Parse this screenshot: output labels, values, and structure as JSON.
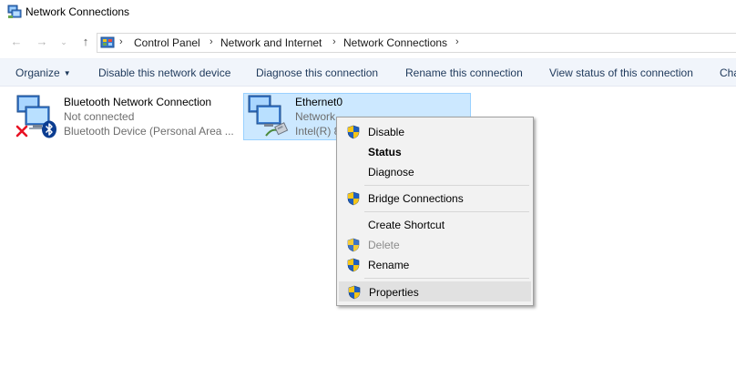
{
  "window": {
    "title": "Network Connections",
    "icon": "network-connections-icon"
  },
  "nav": {
    "back_icon": "back-arrow-icon",
    "forward_icon": "forward-arrow-icon",
    "recent_icon": "chevron-down-icon",
    "up_icon": "up-arrow-icon",
    "breadcrumbs": [
      "Control Panel",
      "Network and Internet",
      "Network Connections"
    ],
    "separator": ">"
  },
  "commandbar": {
    "organize": "Organize",
    "disable": "Disable this network device",
    "diagnose": "Diagnose this connection",
    "rename": "Rename this connection",
    "view_status": "View status of this connection",
    "change": "Cha"
  },
  "connections": [
    {
      "name": "Bluetooth Network Connection",
      "status": "Not connected",
      "device": "Bluetooth Device (Personal Area ...",
      "icon": "network-computers-icon",
      "badges": [
        "red-x-icon",
        "bluetooth-icon"
      ]
    },
    {
      "name": "Ethernet0",
      "status": "Network",
      "device": "Intel(R) 8",
      "icon": "network-computers-icon",
      "badges": [
        "ethernet-cable-icon"
      ],
      "selected": true
    }
  ],
  "context_menu": {
    "items": [
      {
        "label": "Disable",
        "shield": true
      },
      {
        "label": "Status",
        "default": true
      },
      {
        "label": "Diagnose"
      },
      {
        "label": "Bridge Connections",
        "shield": true
      },
      {
        "label": "Create Shortcut"
      },
      {
        "label": "Delete",
        "shield": true,
        "disabled": true
      },
      {
        "label": "Rename",
        "shield": true
      },
      {
        "label": "Properties",
        "shield": true,
        "highlighted": true
      }
    ]
  },
  "colors": {
    "selection_bg": "#cce8ff",
    "selection_border": "#99d1ff",
    "commandbar_bg": "#f1f5fb",
    "commandbar_text": "#1e395b",
    "menu_bg": "#f2f2f2",
    "menu_hover": "#e1e1e1"
  }
}
